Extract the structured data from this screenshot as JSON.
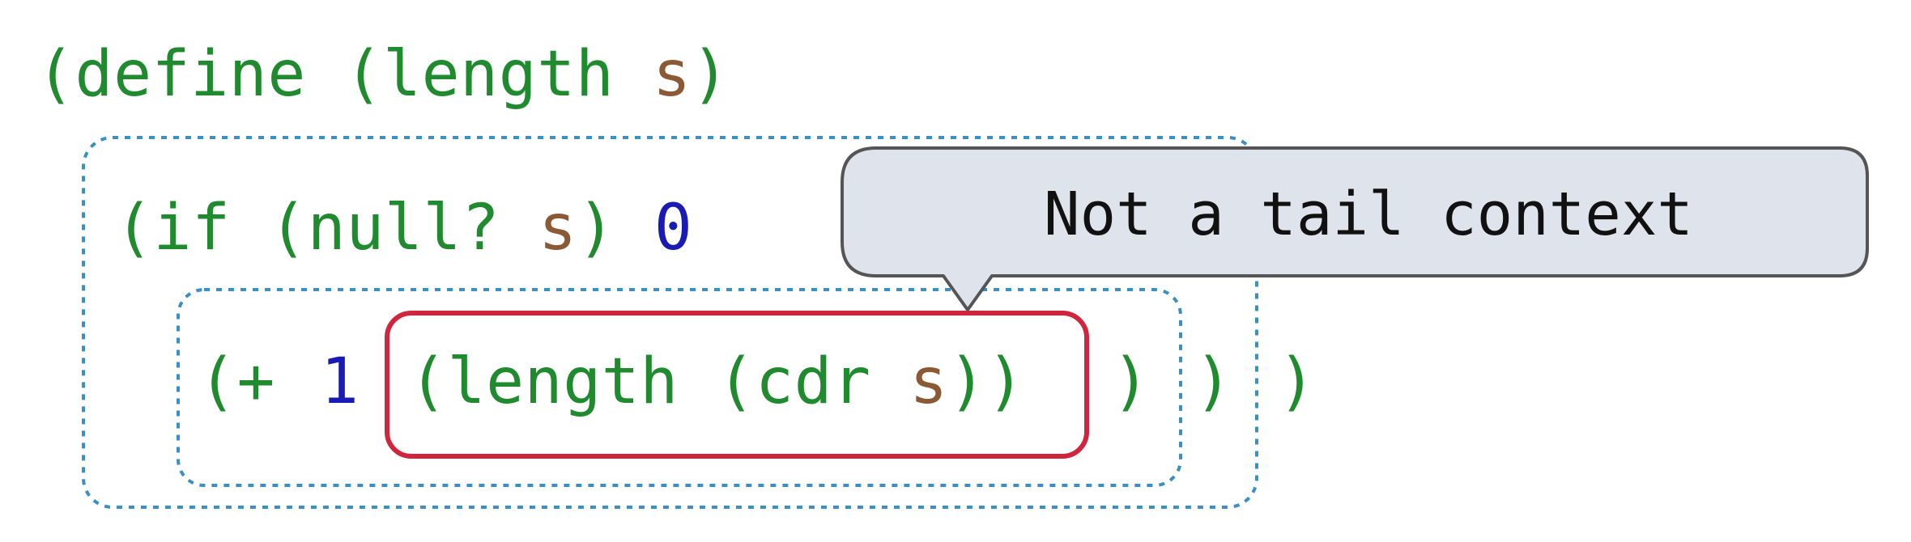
{
  "colors": {
    "keyword": "#1f8a2e",
    "symbol": "#8b5a35",
    "number": "#1a1ab5",
    "box_border": "#3a8fc4",
    "highlight_border": "#d0253d",
    "callout_fill": "#dfe3ec",
    "callout_border": "#555555",
    "callout_text": "#111111"
  },
  "code": {
    "line1": {
      "part1": "(define (length ",
      "part2": "s",
      "part3": ")"
    },
    "line2": {
      "part1": "(if (null? ",
      "part2": "s",
      "part3": ") ",
      "part4": "0"
    },
    "line3": {
      "open": "(+ ",
      "one": "1",
      "call_open": "(length (cdr ",
      "call_arg": "s",
      "call_close": "))",
      "close1": ")",
      "close2": ")",
      "close3": ")"
    }
  },
  "callout": {
    "text": "Not a tail context"
  }
}
